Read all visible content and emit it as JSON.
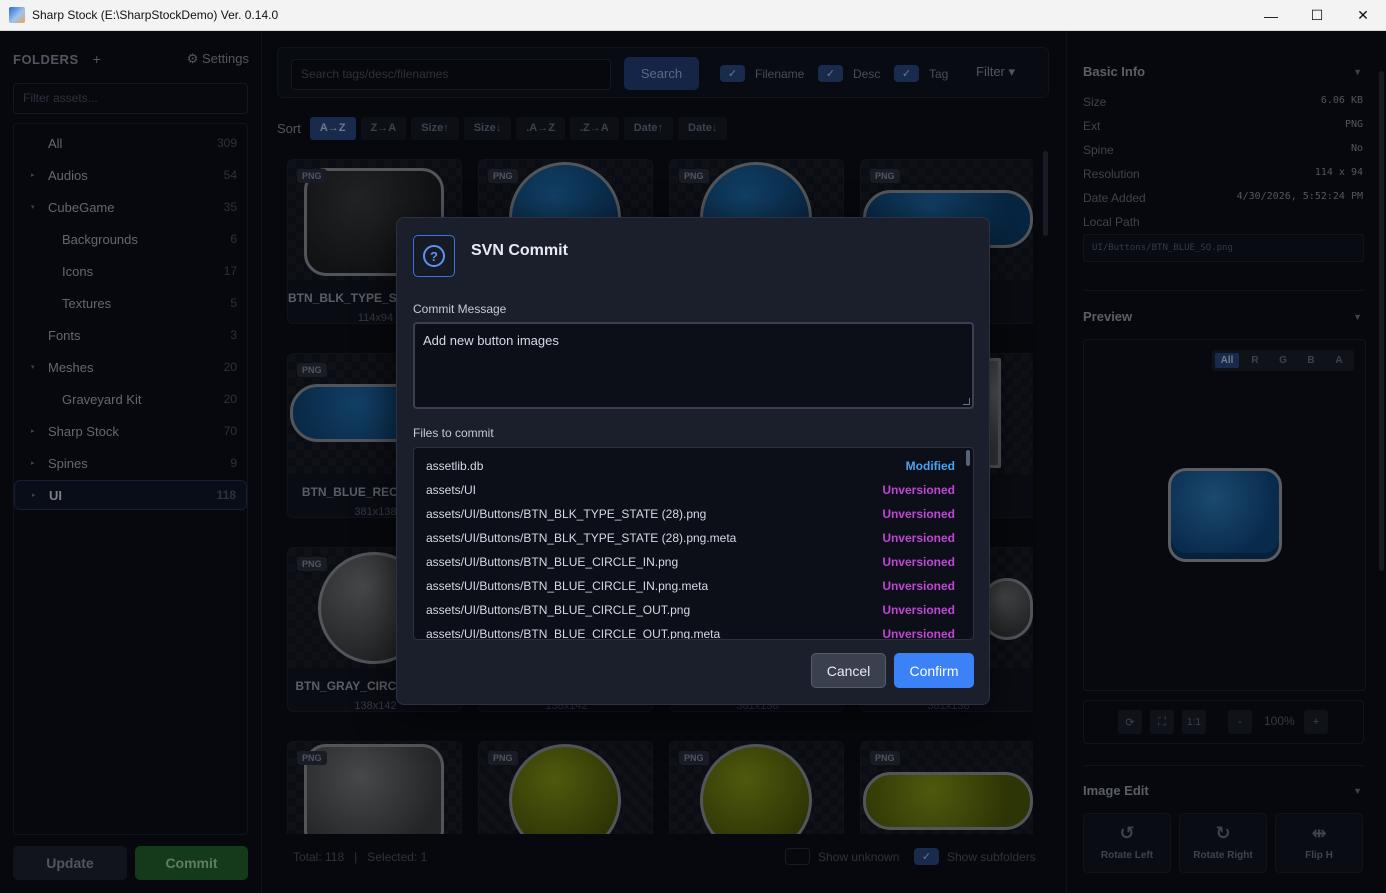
{
  "window": {
    "title": "Sharp Stock (E:\\SharpStockDemo) Ver. 0.14.0",
    "minimize": "—",
    "maximize": "☐",
    "close": "✕"
  },
  "sidebar": {
    "heading": "FOLDERS",
    "add": "+",
    "settings": "⚙ Settings",
    "filter_placeholder": "Filter assets...",
    "items": [
      {
        "label": "All",
        "count": "309",
        "depth": 0,
        "caret": ""
      },
      {
        "label": "Audios",
        "count": "54",
        "depth": 0,
        "caret": "▸"
      },
      {
        "label": "CubeGame",
        "count": "35",
        "depth": 0,
        "caret": "▾"
      },
      {
        "label": "Backgrounds",
        "count": "6",
        "depth": 1,
        "caret": ""
      },
      {
        "label": "Icons",
        "count": "17",
        "depth": 1,
        "caret": ""
      },
      {
        "label": "Textures",
        "count": "5",
        "depth": 1,
        "caret": ""
      },
      {
        "label": "Fonts",
        "count": "3",
        "depth": 0,
        "caret": ""
      },
      {
        "label": "Meshes",
        "count": "20",
        "depth": 0,
        "caret": "▾"
      },
      {
        "label": "Graveyard Kit",
        "count": "20",
        "depth": 1,
        "caret": ""
      },
      {
        "label": "Sharp Stock",
        "count": "70",
        "depth": 0,
        "caret": "▸"
      },
      {
        "label": "Spines",
        "count": "9",
        "depth": 0,
        "caret": "▸"
      },
      {
        "label": "UI",
        "count": "118",
        "depth": 0,
        "caret": "▸",
        "selected": true
      }
    ],
    "update_label": "Update",
    "commit_label": "Commit"
  },
  "search": {
    "placeholder": "Search tags/desc/filenames",
    "button": "Search",
    "filename": "Filename",
    "desc": "Desc",
    "tag": "Tag",
    "filter": "Filter ▾"
  },
  "sort": {
    "label": "Sort",
    "buttons": [
      "A→Z",
      "Z→A",
      "Size↑",
      "Size↓",
      ".A→Z",
      ".Z→A",
      "Date↑",
      "Date↓"
    ]
  },
  "cards": [
    {
      "name": "BTN_BLK_TYPE_STATE (28).png",
      "dims": "114x94",
      "badge": "PNG"
    },
    {
      "name": "",
      "dims": "",
      "badge": "PNG"
    },
    {
      "name": "",
      "dims": "",
      "badge": "PNG"
    },
    {
      "name": ".png",
      "dims": "",
      "badge": "PNG"
    },
    {
      "name": "BTN_BLUE_RECT_IN.png",
      "dims": "381x138",
      "badge": "PNG"
    },
    {
      "name": "",
      "dims": "",
      "badge": ""
    },
    {
      "name": "",
      "dims": "",
      "badge": ""
    },
    {
      "name": "T.png",
      "dims": "",
      "badge": ""
    },
    {
      "name": "BTN_GRAY_CIRCLE_IN.png",
      "dims": "138x142",
      "badge": "PNG"
    },
    {
      "name": "",
      "dims": "138x142",
      "badge": ""
    },
    {
      "name": "",
      "dims": "381x138",
      "badge": ""
    },
    {
      "name": "T.png",
      "dims": "381x138",
      "badge": ""
    },
    {
      "name": "",
      "dims": "",
      "badge": "PNG"
    },
    {
      "name": "",
      "dims": "",
      "badge": "PNG"
    },
    {
      "name": "",
      "dims": "",
      "badge": "PNG"
    },
    {
      "name": "",
      "dims": "",
      "badge": "PNG"
    }
  ],
  "status": {
    "total": "Total: 118",
    "sep": "|",
    "selected": "Selected: 1",
    "show_unknown": "Show unknown",
    "show_subfolders": "Show subfolders"
  },
  "info": {
    "title": "Basic Info",
    "rows": [
      {
        "k": "Size",
        "v": "6.06 KB"
      },
      {
        "k": "Ext",
        "v": "PNG"
      },
      {
        "k": "Spine",
        "v": "No"
      },
      {
        "k": "Resolution",
        "v": "114 x 94"
      },
      {
        "k": "Date Added",
        "v": "4/30/2026, 5:52:24 PM"
      }
    ],
    "local_path_label": "Local Path",
    "local_path": "UI/Buttons/BTN_BLUE_SQ.png"
  },
  "preview": {
    "title": "Preview",
    "channels": [
      "All",
      "R",
      "G",
      "B",
      "A"
    ],
    "reset": "⟳",
    "fit": "⛶",
    "one": "1:1",
    "minus": "-",
    "zoom": "100%",
    "plus": "+"
  },
  "edit": {
    "title": "Image Edit",
    "rotate_left": "Rotate Left",
    "rotate_right": "Rotate Right",
    "flip_h": "Flip H"
  },
  "dialog": {
    "title": "SVN Commit",
    "icon": "?",
    "msg_label": "Commit Message",
    "msg_value": "Add new button images",
    "files_label": "Files to commit",
    "files": [
      {
        "path": "assetlib.db",
        "status": "Modified"
      },
      {
        "path": "assets/UI",
        "status": "Unversioned"
      },
      {
        "path": "assets/UI/Buttons/BTN_BLK_TYPE_STATE (28).png",
        "status": "Unversioned"
      },
      {
        "path": "assets/UI/Buttons/BTN_BLK_TYPE_STATE (28).png.meta",
        "status": "Unversioned"
      },
      {
        "path": "assets/UI/Buttons/BTN_BLUE_CIRCLE_IN.png",
        "status": "Unversioned"
      },
      {
        "path": "assets/UI/Buttons/BTN_BLUE_CIRCLE_IN.png.meta",
        "status": "Unversioned"
      },
      {
        "path": "assets/UI/Buttons/BTN_BLUE_CIRCLE_OUT.png",
        "status": "Unversioned"
      },
      {
        "path": "assets/UI/Buttons/BTN_BLUE_CIRCLE_OUT.png.meta",
        "status": "Unversioned"
      }
    ],
    "cancel": "Cancel",
    "confirm": "Confirm"
  },
  "colors": {
    "modified": "#4aa3f0",
    "unversioned": "#c045d8",
    "accent": "#3b82f6",
    "commit_green": "#24632f"
  }
}
